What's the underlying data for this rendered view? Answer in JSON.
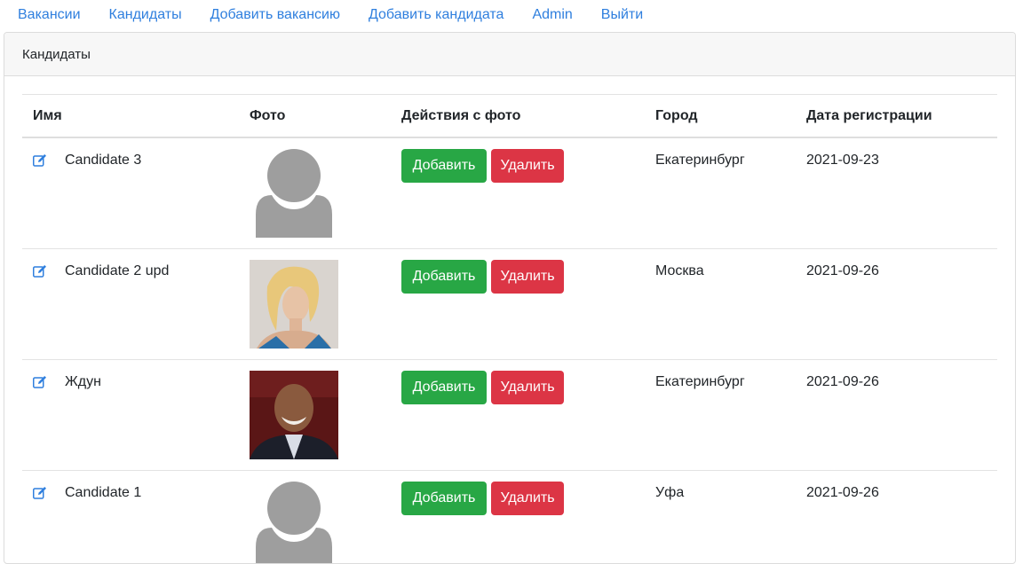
{
  "nav": {
    "items": [
      {
        "label": "Вакансии"
      },
      {
        "label": "Кандидаты"
      },
      {
        "label": "Добавить вакансию"
      },
      {
        "label": "Добавить кандидата"
      },
      {
        "label": "Admin"
      },
      {
        "label": "Выйти"
      }
    ],
    "color": "#2f7fde"
  },
  "card": {
    "title": "Кандидаты"
  },
  "table": {
    "headers": {
      "name": "Имя",
      "photo": "Фото",
      "actions": "Действия с фото",
      "city": "Город",
      "date": "Дата регистрации"
    },
    "add_label": "Добавить",
    "delete_label": "Удалить",
    "rows": [
      {
        "name": "Candidate 3",
        "city": "Екатеринбург",
        "date": "2021-09-23",
        "photo": "placeholder-avatar"
      },
      {
        "name": "Candidate 2 upd",
        "city": "Москва",
        "date": "2021-09-26",
        "photo": "woman-portrait"
      },
      {
        "name": "Ждун",
        "city": "Екатеринбург",
        "date": "2021-09-26",
        "photo": "man-portrait"
      },
      {
        "name": "Candidate 1",
        "city": "Уфа",
        "date": "2021-09-26",
        "photo": "placeholder-avatar"
      }
    ]
  },
  "colors": {
    "add": "#28a745",
    "delete": "#dc3545",
    "edit_icon": "#2f7fde"
  }
}
